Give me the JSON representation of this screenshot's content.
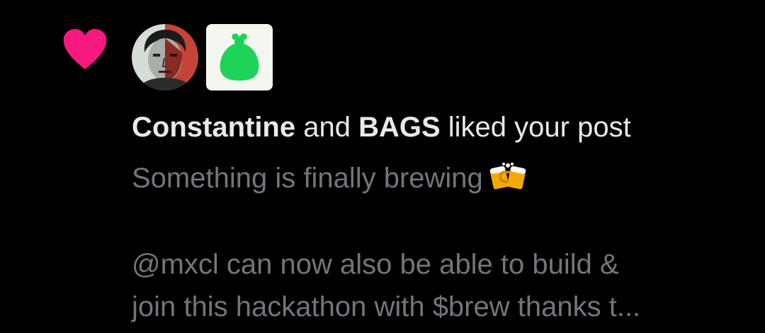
{
  "notification": {
    "icon": "heart-icon",
    "heart_color": "#f91880",
    "avatars": [
      {
        "name": "Constantine",
        "icon": "constantine-avatar"
      },
      {
        "name": "BAGS",
        "icon": "money-bag-icon",
        "icon_color": "#1ed35a"
      }
    ],
    "headline": {
      "user1": "Constantine",
      "conj": " and ",
      "user2": "BAGS",
      "suffix": " liked your post"
    },
    "post_preview": {
      "line1": "Something is finally brewing",
      "line1_emoji": "clinking-beer-mugs-icon",
      "line2": "@mxcl can now also be able to build &",
      "line3": "join this hackathon with $brew thanks t..."
    }
  }
}
